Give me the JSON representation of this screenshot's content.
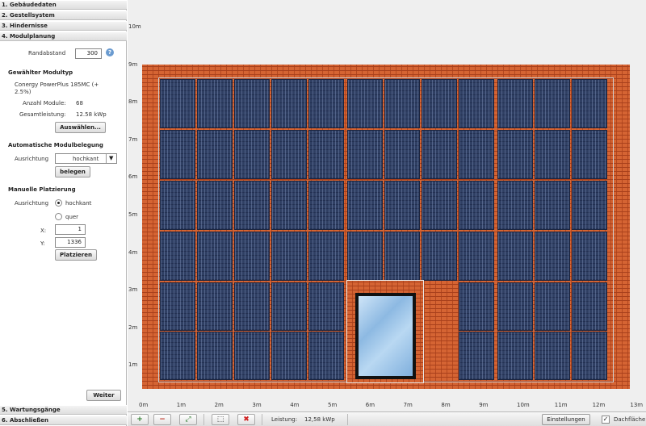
{
  "sidebar": {
    "sections": [
      "1. Gebäudedaten",
      "2. Gestellsystem",
      "3. Hindernisse",
      "4. Modulplanung",
      "5. Wartungsgänge",
      "6. Abschließen"
    ],
    "randabstand_label": "Randabstand",
    "randabstand_value": "300",
    "help_icon": "?",
    "modultyp_heading": "Gewählter Modultyp",
    "modultyp_name": "Conergy PowerPlus 185MC (+",
    "modultyp_name2": "2.5%)",
    "anzahl_label": "Anzahl Module:",
    "anzahl_value": "68",
    "gesamt_label": "Gesamtleistung:",
    "gesamt_value": "12.58 kWp",
    "auswaehlen_button": "Auswählen...",
    "auto_heading": "Automatische Modulbelegung",
    "auto_ausrichtung_label": "Ausrichtung",
    "auto_ausrichtung_value": "hochkant",
    "belegen_button": "belegen",
    "manual_heading": "Manuelle Platzierung",
    "manual_ausrichtung_label": "Ausrichtung",
    "radio_hochkant": "hochkant",
    "radio_quer": "quer",
    "x_label": "X:",
    "x_value": "1",
    "y_label": "Y:",
    "y_value": "1336",
    "platzieren_button": "Platzieren",
    "weiter_button": "Weiter"
  },
  "canvas": {
    "x_ticks": [
      "0m",
      "1m",
      "2m",
      "3m",
      "4m",
      "5m",
      "6m",
      "7m",
      "8m",
      "9m",
      "10m",
      "11m",
      "12m",
      "13m"
    ],
    "y_ticks": [
      "10m",
      "9m",
      "8m",
      "7m",
      "6m",
      "5m",
      "4m",
      "3m",
      "2m",
      "1m"
    ]
  },
  "toolbar": {
    "zoom_in_icon": "+",
    "zoom_out_icon": "−",
    "fit_icon": "⤢",
    "select_icon": "⬚",
    "delete_icon": "✖",
    "leistung_label": "Leistung:",
    "leistung_value": "12,58 kWp",
    "einstellungen_button": "Einstellungen",
    "checkbox_mark": "✓",
    "dachflaeche_label": "Dachfläche"
  },
  "colors": {
    "roof": "#d56433",
    "panel": "#2f3f63",
    "window": "#9cc4e8"
  }
}
